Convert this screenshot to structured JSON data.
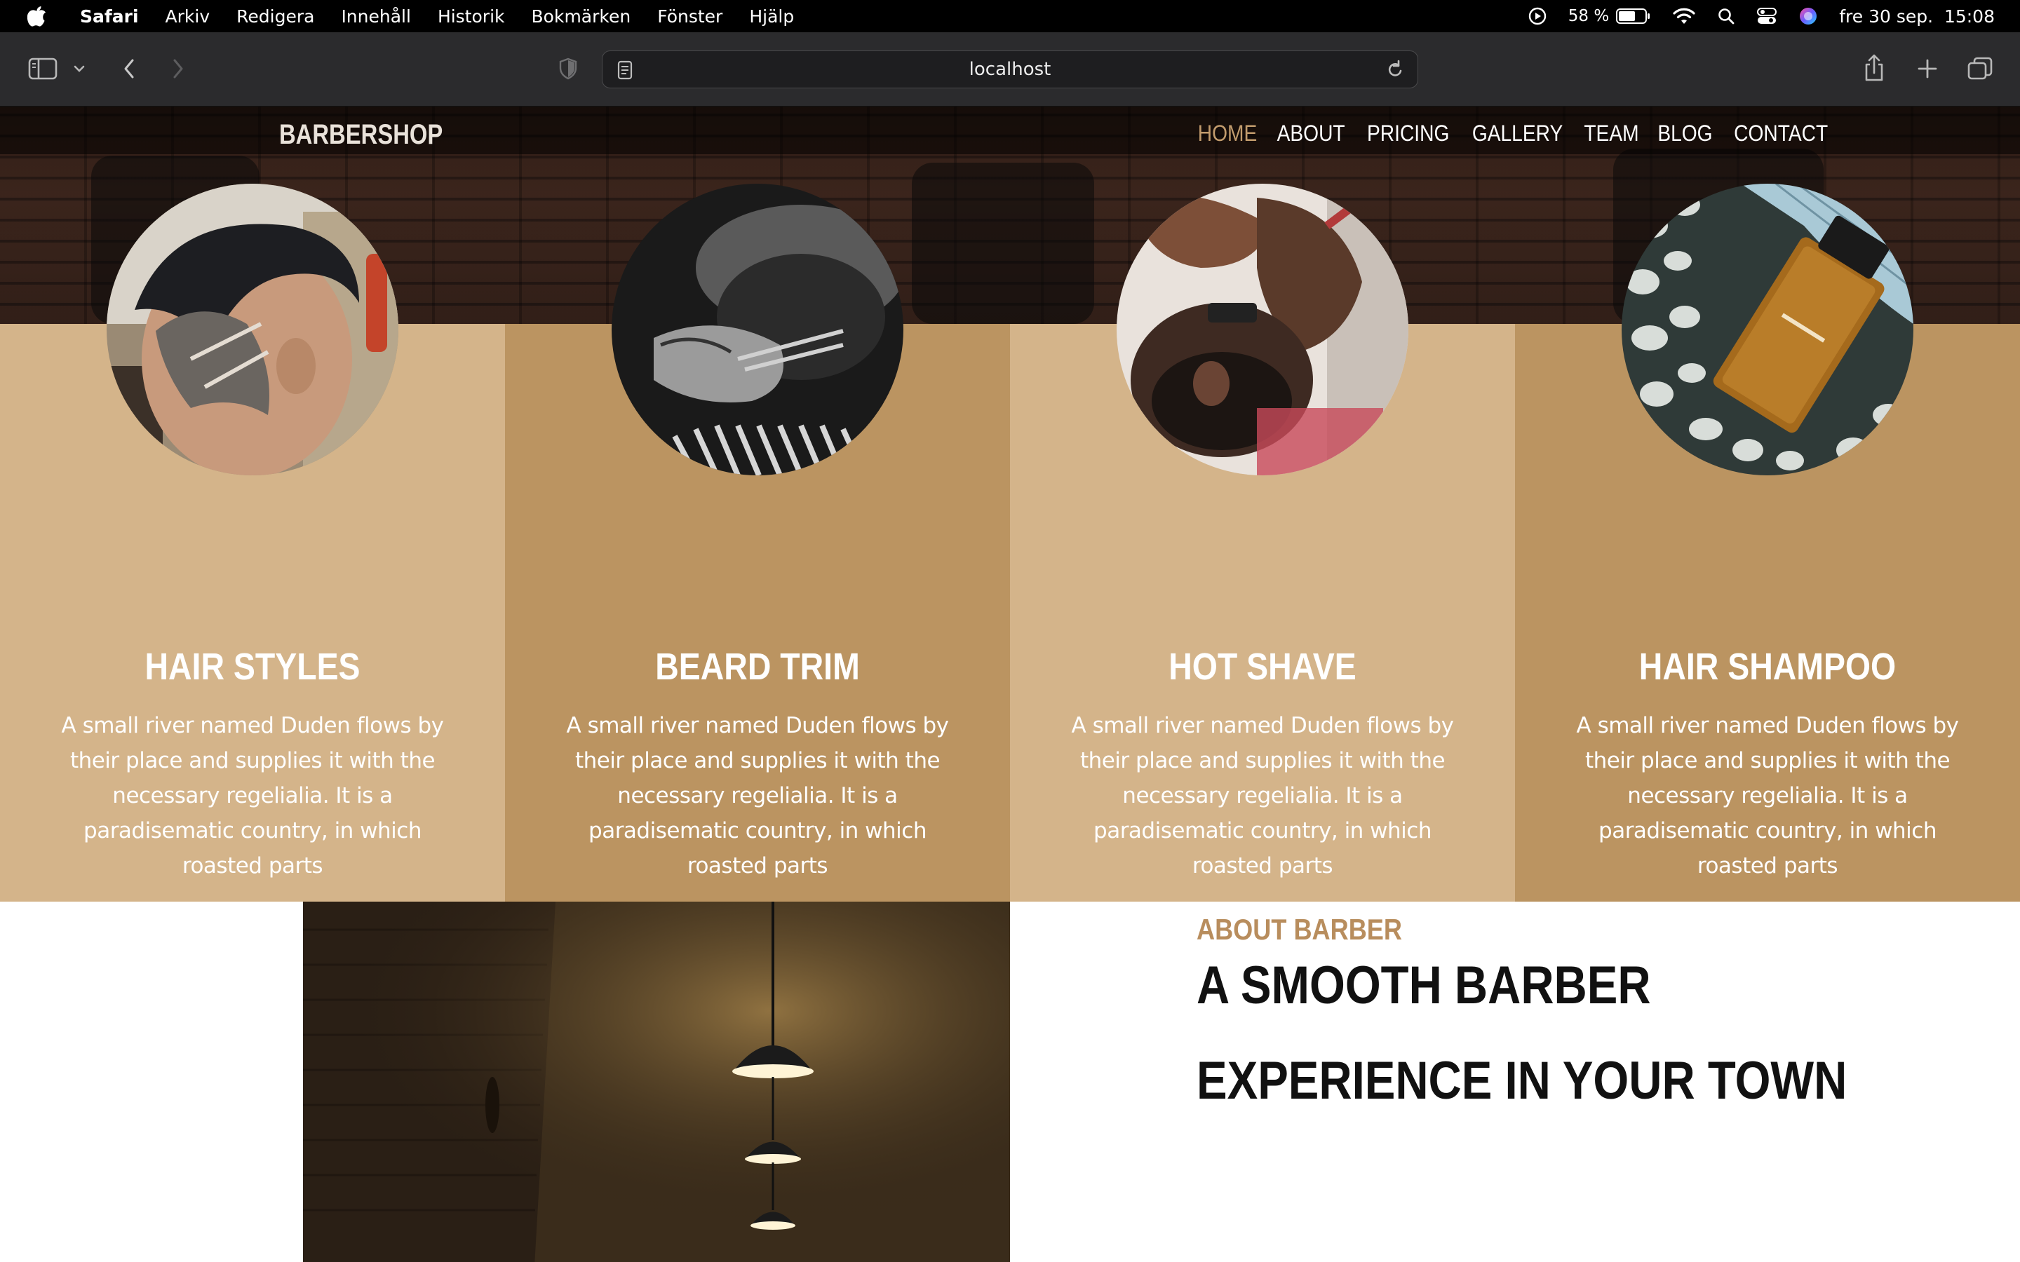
{
  "menubar": {
    "app_name": "Safari",
    "items": [
      "Arkiv",
      "Redigera",
      "Innehåll",
      "Historik",
      "Bokmärken",
      "Fönster",
      "Hjälp"
    ],
    "battery_percent": "58 %",
    "datetime": "fre 30 sep.  15:08"
  },
  "browser": {
    "url": "localhost"
  },
  "site": {
    "brand": "BARBERSHOP",
    "nav": [
      "HOME",
      "ABOUT",
      "PRICING",
      "GALLERY",
      "TEAM",
      "BLOG",
      "CONTACT"
    ],
    "active_nav": "HOME",
    "colors": {
      "accent": "#c29c6d",
      "card_light": "#d4b48a",
      "card_dark": "#bb9461",
      "about_kicker": "#b88d5d"
    },
    "services": [
      {
        "title": "HAIR STYLES",
        "text": "A small river named Duden flows by their place and supplies it with the necessary regelialia. It is a paradisematic country, in which roasted parts"
      },
      {
        "title": "BEARD TRIM",
        "text": "A small river named Duden flows by their place and supplies it with the necessary regelialia. It is a paradisematic country, in which roasted parts"
      },
      {
        "title": "HOT SHAVE",
        "text": "A small river named Duden flows by their place and supplies it with the necessary regelialia. It is a paradisematic country, in which roasted parts"
      },
      {
        "title": "HAIR SHAMPOO",
        "text": "A small river named Duden flows by their place and supplies it with the necessary regelialia. It is a paradisematic country, in which roasted parts"
      }
    ],
    "about": {
      "kicker": "ABOUT BARBER",
      "title_line1": "A SMOOTH BARBER",
      "title_line2": "EXPERIENCE IN YOUR TOWN"
    }
  }
}
